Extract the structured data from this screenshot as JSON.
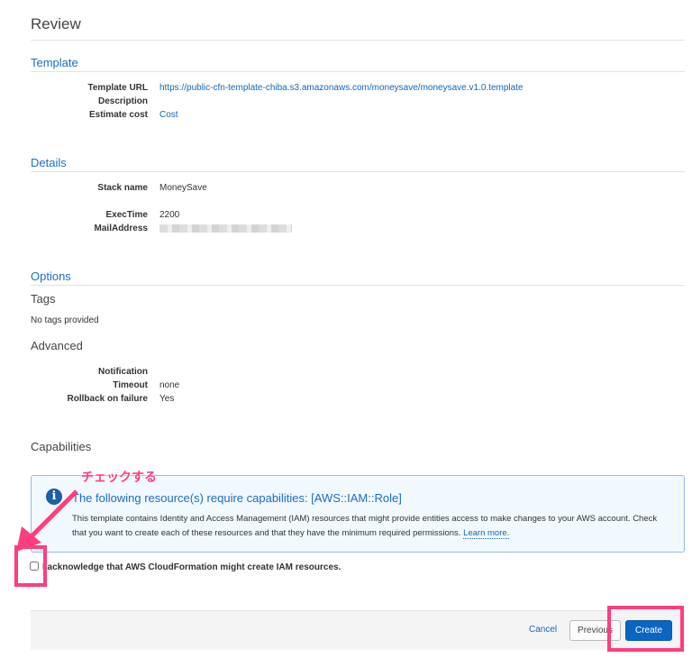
{
  "title": "Review",
  "template": {
    "heading": "Template",
    "rows": [
      {
        "label": "Template URL",
        "value": "https://public-cfn-template-chiba.s3.amazonaws.com/moneysave/moneysave.v1.0.template"
      },
      {
        "label": "Description",
        "value": ""
      },
      {
        "label": "Estimate cost",
        "value": "Cost"
      }
    ]
  },
  "details": {
    "heading": "Details",
    "rows": [
      {
        "label": "Stack name",
        "value": "MoneySave"
      },
      {
        "label": "ExecTime",
        "value": "2200"
      },
      {
        "label": "MailAddress",
        "value": ""
      }
    ]
  },
  "options": {
    "heading": "Options",
    "tags_heading": "Tags",
    "tags_text": "No tags provided",
    "advanced_heading": "Advanced",
    "rows": [
      {
        "label": "Notification",
        "value": ""
      },
      {
        "label": "Timeout",
        "value": "none"
      },
      {
        "label": "Rollback on failure",
        "value": "Yes"
      }
    ]
  },
  "capabilities": {
    "heading": "Capabilities",
    "info_title": "The following resource(s) require capabilities: [AWS::IAM::Role]",
    "info_text": "This template contains Identity and Access Management (IAM) resources that might provide entities access to make changes to your AWS account. Check that you want to create each of these resources and that they have the minimum required permissions.",
    "learn_more": "Learn more.",
    "acknowledge": "I acknowledge that AWS CloudFormation might create IAM resources.",
    "acknowledged": false
  },
  "annotation": "チェックする",
  "footer": {
    "cancel": "Cancel",
    "previous": "Previous",
    "create": "Create"
  },
  "colors": {
    "accent": "#1a6fc0",
    "highlight": "#ff3e7f",
    "primary": "#0a66c2"
  }
}
